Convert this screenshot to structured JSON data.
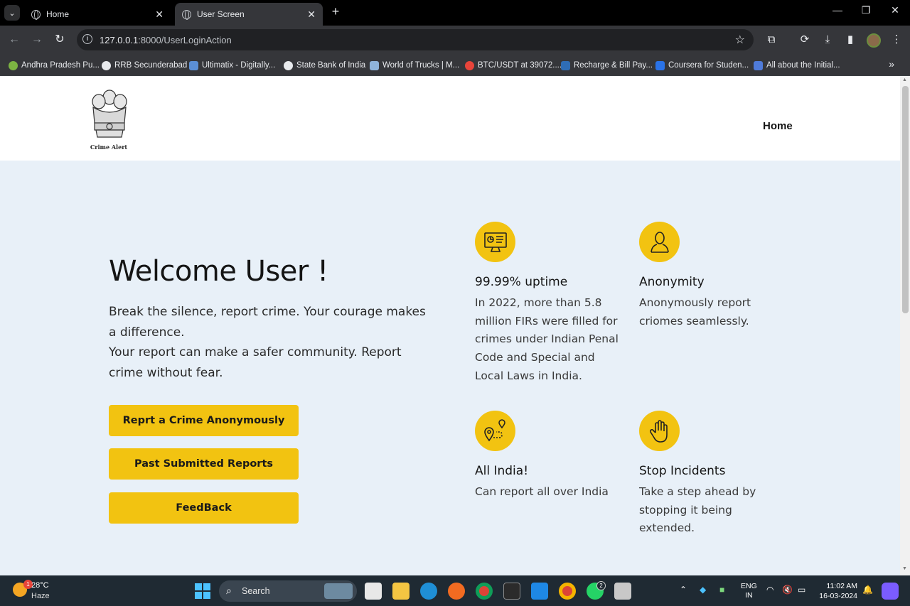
{
  "browser": {
    "tabs": [
      {
        "title": "Home"
      },
      {
        "title": "User Screen"
      }
    ],
    "new_tab": "+",
    "url_host": "127.0.0.1",
    "url_rest": ":8000/UserLoginAction",
    "bookmarks": [
      {
        "label": "Andhra Pradesh Pu...",
        "color": "#7cb342"
      },
      {
        "label": "RRB Secunderabad",
        "color": "#e8eaed"
      },
      {
        "label": "Ultimatix - Digitally...",
        "color": "#5b8fd6"
      },
      {
        "label": "State Bank of India",
        "color": "#e8eaed"
      },
      {
        "label": "World of Trucks | M...",
        "color": "#8fb3d9"
      },
      {
        "label": "BTC/USDT at 39072....",
        "color": "#e8443a"
      },
      {
        "label": "Recharge & Bill Pay...",
        "color": "#2f6db5"
      },
      {
        "label": "Coursera for Studen...",
        "color": "#2a73e8"
      },
      {
        "label": "All about the Initial...",
        "color": "#4f7bd9"
      }
    ]
  },
  "site": {
    "logo_text": "Crime Alert",
    "nav_home": "Home",
    "welcome": "Welcome User !",
    "intro_line1": "Break the silence, report crime. Your courage makes a difference.",
    "intro_line2": "Your report can make a safer community. Report crime without fear.",
    "buttons": {
      "report": "Reprt a Crime Anonymously",
      "past": "Past Submitted Reports",
      "feedback": "FeedBack"
    },
    "features": [
      {
        "title": "99.99% uptime",
        "text": "In 2022, more than 5.8 million FIRs were filled for crimes under Indian Penal Code and Special and Local Laws in India.",
        "icon": "monitor-dashboard-icon"
      },
      {
        "title": "Anonymity",
        "text": "Anonymously report criomes seamlessly.",
        "icon": "user-silhouette-icon"
      },
      {
        "title": "All India!",
        "text": "Can report all over India",
        "icon": "location-route-icon"
      },
      {
        "title": "Stop Incidents",
        "text": "Take a step ahead by stopping it being extended.",
        "icon": "raised-hand-icon"
      }
    ],
    "accent_color": "#f2c311",
    "background_color": "#e8f0f8"
  },
  "taskbar": {
    "weather_badge": "1",
    "temperature": "28°C",
    "condition": "Haze",
    "search_placeholder": "Search",
    "whatsapp_badge": "2",
    "lang_line1": "ENG",
    "lang_line2": "IN",
    "time": "11:02 AM",
    "date": "16-03-2024"
  }
}
